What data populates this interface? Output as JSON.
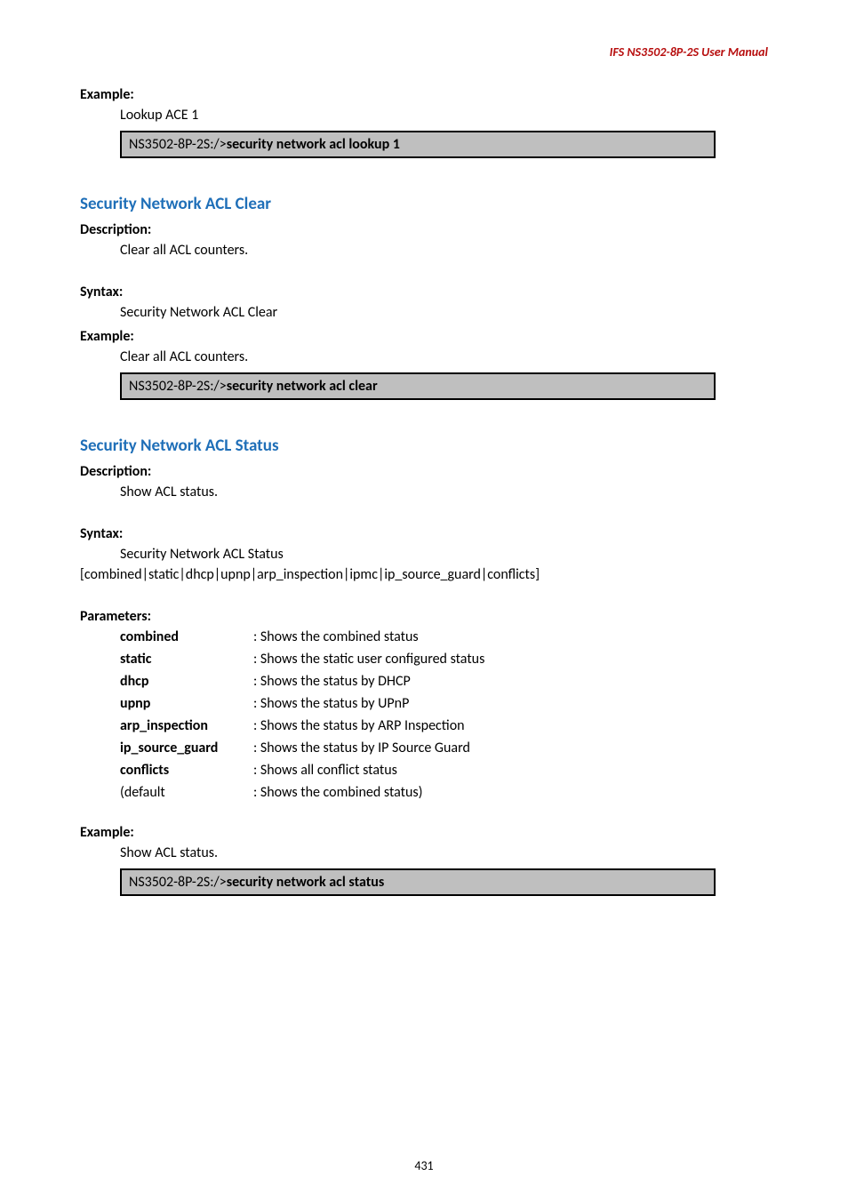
{
  "header": "IFS  NS3502-8P-2S  User  Manual",
  "s1": {
    "exampleLabel": "Example:",
    "exampleText": "Lookup ACE 1",
    "codePrefix": "NS3502-8P-2S:/>",
    "codeCommand": "security network acl lookup 1"
  },
  "s2": {
    "heading": "Security Network ACL Clear",
    "descLabel": "Description:",
    "descText": "Clear all ACL counters.",
    "syntaxLabel": "Syntax:",
    "syntaxText": "Security Network ACL Clear",
    "exampleLabel": "Example:",
    "exampleText": "Clear all ACL counters.",
    "codePrefix": "NS3502-8P-2S:/>",
    "codeCommand": "security network acl clear"
  },
  "s3": {
    "heading": "Security Network ACL Status",
    "descLabel": "Description:",
    "descText": "Show ACL status.",
    "syntaxLabel": "Syntax:",
    "syntaxText1": "Security Network ACL Status",
    "syntaxText2": "[combined|static|dhcp|upnp|arp_inspection|ipmc|ip_source_guard|conflicts]",
    "paramsLabel": "Parameters:",
    "params": [
      {
        "name": "combined",
        "desc": "   : Shows the combined status"
      },
      {
        "name": "static",
        "desc": "  : Shows the static user configured status"
      },
      {
        "name": "dhcp",
        "desc": "     : Shows the status by DHCP"
      },
      {
        "name": "upnp",
        "desc": "     : Shows the status by UPnP"
      },
      {
        "name": "arp_inspection",
        "desc": ": Shows the status by ARP Inspection"
      },
      {
        "name": "ip_source_guard",
        "desc": ": Shows the status by IP Source Guard"
      },
      {
        "name": "conflicts",
        "desc": " : Shows all conflict status"
      }
    ],
    "defaultName": "(default",
    "defaultDesc": "  : Shows the combined status)",
    "exampleLabel": "Example:",
    "exampleText": "Show ACL status.",
    "codePrefix": "NS3502-8P-2S:/>",
    "codeCommand": "security network acl status"
  },
  "pageNumber": "431"
}
